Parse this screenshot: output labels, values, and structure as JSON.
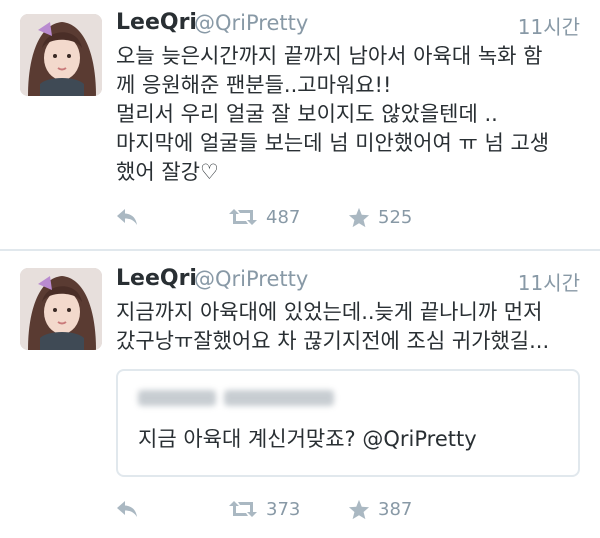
{
  "colors": {
    "text": "#292f33",
    "muted": "#8899a6",
    "divider": "#e1e8ed",
    "icon": "#aab8c2"
  },
  "tweets": [
    {
      "display_name": "LeeQri",
      "handle": "@QriPretty",
      "time": "11시간",
      "lines": [
        "오늘 늦은시간까지 끝까지 남아서 아육대 녹화  함",
        "께 응원해준 팬분들..고마워요!!",
        "멀리서 우리 얼굴  잘 보이지도 않았을텐데 ..",
        "마지막에 얼굴들 보는데 넘 미안했어여 ㅠ 넘 고생",
        "했어 잘강♡"
      ],
      "retweets": "487",
      "favorites": "525"
    },
    {
      "display_name": "LeeQri",
      "handle": "@QriPretty",
      "time": "11시간",
      "lines": [
        "지금까지 아육대에 있었는데..늦게 끝나니까 먼저",
        "갔구낭ㅠ잘했어요 차 끊기지전에 조심 귀가했길..."
      ],
      "quote": {
        "text": "지금 아육대 계신거맞죠? @QriPretty"
      },
      "retweets": "373",
      "favorites": "387"
    }
  ],
  "icons": {
    "reply": "reply-icon",
    "retweet": "retweet-icon",
    "favorite": "star-icon"
  }
}
